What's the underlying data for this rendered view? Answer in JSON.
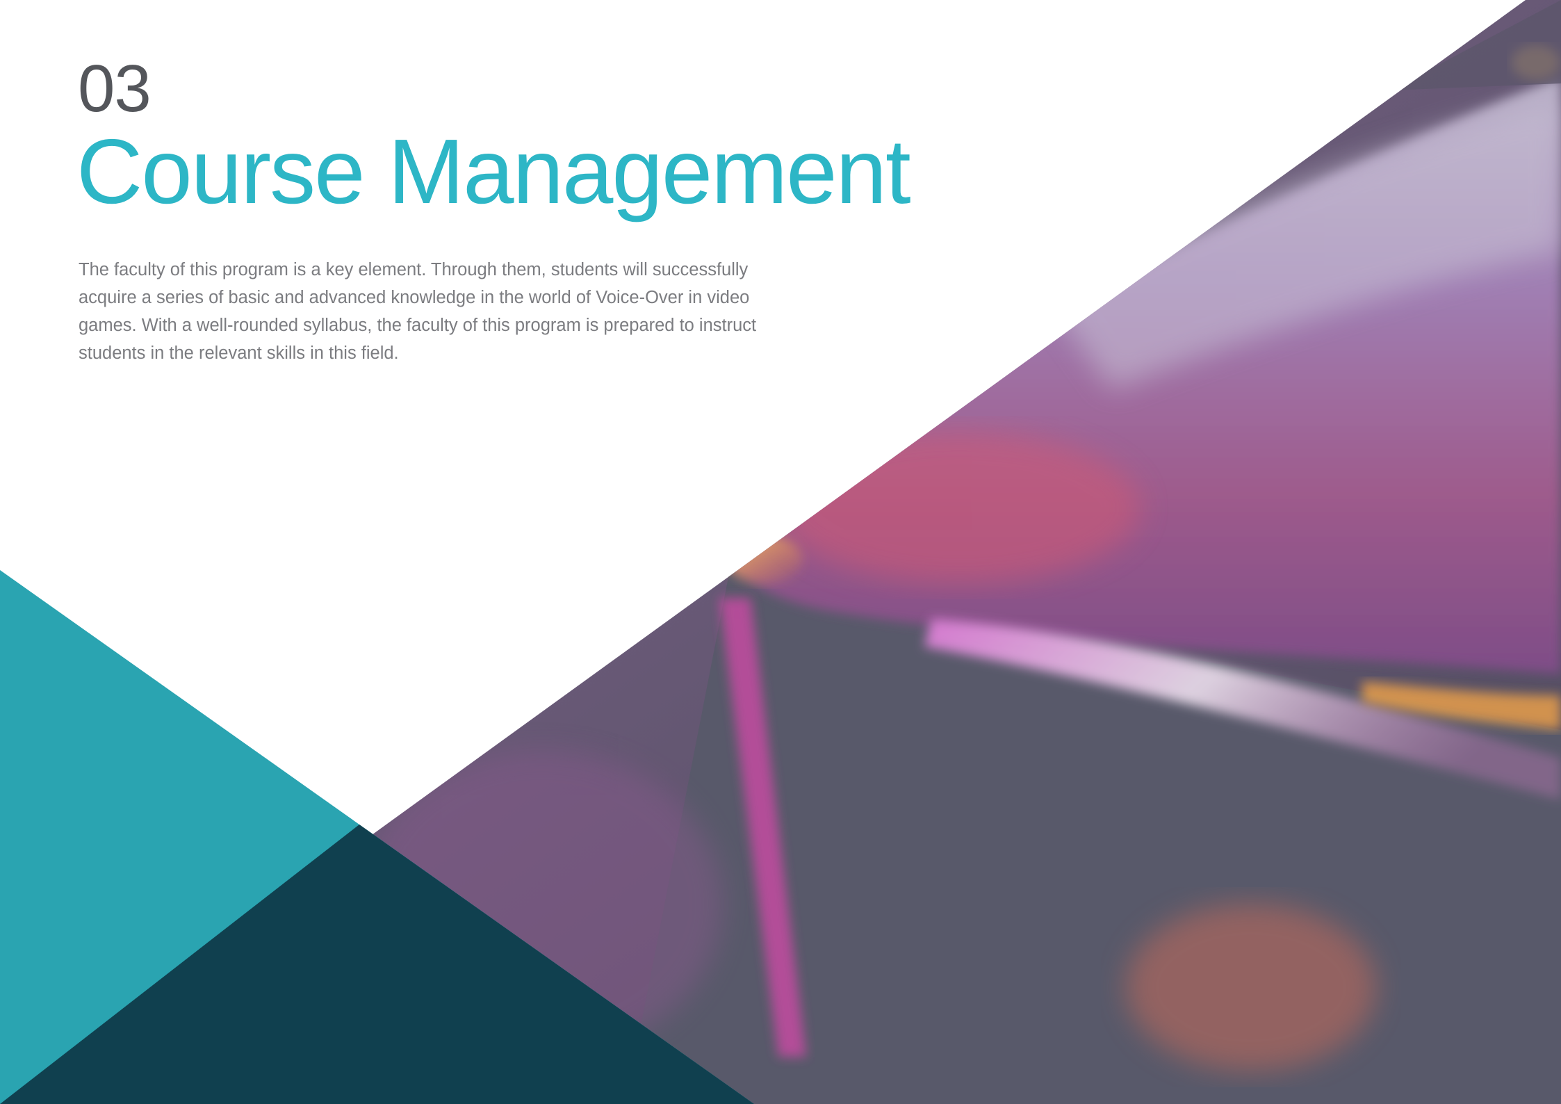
{
  "section": {
    "number": "03",
    "title": "Course Management",
    "body": "The faculty of this program is a key element. Through them, students will successfully acquire a series of basic and advanced knowledge in the world of Voice-Over in video games. With a well-rounded syllabus, the faculty of this program is prepared to instruct students in the relevant skills in this field."
  },
  "colors": {
    "accent": "#2db6c6",
    "teal_triangle": "#2aa4b1",
    "dark_overlap": "#10404f",
    "number_gray": "#54565b",
    "body_gray": "#7b7c80"
  }
}
